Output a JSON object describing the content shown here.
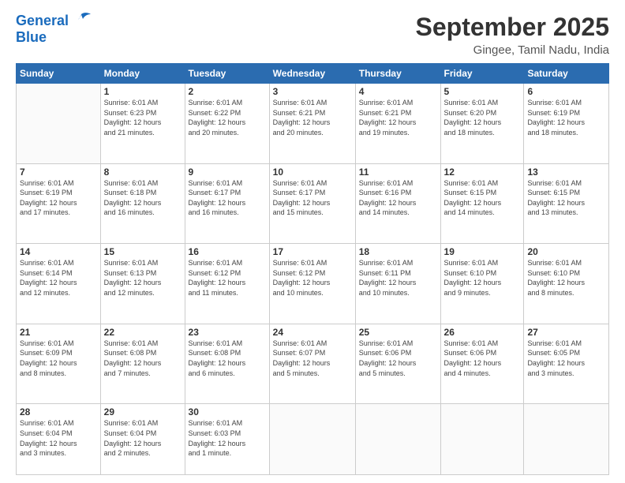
{
  "logo": {
    "line1": "General",
    "line2": "Blue"
  },
  "title": "September 2025",
  "location": "Gingee, Tamil Nadu, India",
  "weekdays": [
    "Sunday",
    "Monday",
    "Tuesday",
    "Wednesday",
    "Thursday",
    "Friday",
    "Saturday"
  ],
  "weeks": [
    [
      {
        "day": "",
        "info": ""
      },
      {
        "day": "1",
        "info": "Sunrise: 6:01 AM\nSunset: 6:23 PM\nDaylight: 12 hours\nand 21 minutes."
      },
      {
        "day": "2",
        "info": "Sunrise: 6:01 AM\nSunset: 6:22 PM\nDaylight: 12 hours\nand 20 minutes."
      },
      {
        "day": "3",
        "info": "Sunrise: 6:01 AM\nSunset: 6:21 PM\nDaylight: 12 hours\nand 20 minutes."
      },
      {
        "day": "4",
        "info": "Sunrise: 6:01 AM\nSunset: 6:21 PM\nDaylight: 12 hours\nand 19 minutes."
      },
      {
        "day": "5",
        "info": "Sunrise: 6:01 AM\nSunset: 6:20 PM\nDaylight: 12 hours\nand 18 minutes."
      },
      {
        "day": "6",
        "info": "Sunrise: 6:01 AM\nSunset: 6:19 PM\nDaylight: 12 hours\nand 18 minutes."
      }
    ],
    [
      {
        "day": "7",
        "info": "Sunrise: 6:01 AM\nSunset: 6:19 PM\nDaylight: 12 hours\nand 17 minutes."
      },
      {
        "day": "8",
        "info": "Sunrise: 6:01 AM\nSunset: 6:18 PM\nDaylight: 12 hours\nand 16 minutes."
      },
      {
        "day": "9",
        "info": "Sunrise: 6:01 AM\nSunset: 6:17 PM\nDaylight: 12 hours\nand 16 minutes."
      },
      {
        "day": "10",
        "info": "Sunrise: 6:01 AM\nSunset: 6:17 PM\nDaylight: 12 hours\nand 15 minutes."
      },
      {
        "day": "11",
        "info": "Sunrise: 6:01 AM\nSunset: 6:16 PM\nDaylight: 12 hours\nand 14 minutes."
      },
      {
        "day": "12",
        "info": "Sunrise: 6:01 AM\nSunset: 6:15 PM\nDaylight: 12 hours\nand 14 minutes."
      },
      {
        "day": "13",
        "info": "Sunrise: 6:01 AM\nSunset: 6:15 PM\nDaylight: 12 hours\nand 13 minutes."
      }
    ],
    [
      {
        "day": "14",
        "info": "Sunrise: 6:01 AM\nSunset: 6:14 PM\nDaylight: 12 hours\nand 12 minutes."
      },
      {
        "day": "15",
        "info": "Sunrise: 6:01 AM\nSunset: 6:13 PM\nDaylight: 12 hours\nand 12 minutes."
      },
      {
        "day": "16",
        "info": "Sunrise: 6:01 AM\nSunset: 6:12 PM\nDaylight: 12 hours\nand 11 minutes."
      },
      {
        "day": "17",
        "info": "Sunrise: 6:01 AM\nSunset: 6:12 PM\nDaylight: 12 hours\nand 10 minutes."
      },
      {
        "day": "18",
        "info": "Sunrise: 6:01 AM\nSunset: 6:11 PM\nDaylight: 12 hours\nand 10 minutes."
      },
      {
        "day": "19",
        "info": "Sunrise: 6:01 AM\nSunset: 6:10 PM\nDaylight: 12 hours\nand 9 minutes."
      },
      {
        "day": "20",
        "info": "Sunrise: 6:01 AM\nSunset: 6:10 PM\nDaylight: 12 hours\nand 8 minutes."
      }
    ],
    [
      {
        "day": "21",
        "info": "Sunrise: 6:01 AM\nSunset: 6:09 PM\nDaylight: 12 hours\nand 8 minutes."
      },
      {
        "day": "22",
        "info": "Sunrise: 6:01 AM\nSunset: 6:08 PM\nDaylight: 12 hours\nand 7 minutes."
      },
      {
        "day": "23",
        "info": "Sunrise: 6:01 AM\nSunset: 6:08 PM\nDaylight: 12 hours\nand 6 minutes."
      },
      {
        "day": "24",
        "info": "Sunrise: 6:01 AM\nSunset: 6:07 PM\nDaylight: 12 hours\nand 5 minutes."
      },
      {
        "day": "25",
        "info": "Sunrise: 6:01 AM\nSunset: 6:06 PM\nDaylight: 12 hours\nand 5 minutes."
      },
      {
        "day": "26",
        "info": "Sunrise: 6:01 AM\nSunset: 6:06 PM\nDaylight: 12 hours\nand 4 minutes."
      },
      {
        "day": "27",
        "info": "Sunrise: 6:01 AM\nSunset: 6:05 PM\nDaylight: 12 hours\nand 3 minutes."
      }
    ],
    [
      {
        "day": "28",
        "info": "Sunrise: 6:01 AM\nSunset: 6:04 PM\nDaylight: 12 hours\nand 3 minutes."
      },
      {
        "day": "29",
        "info": "Sunrise: 6:01 AM\nSunset: 6:04 PM\nDaylight: 12 hours\nand 2 minutes."
      },
      {
        "day": "30",
        "info": "Sunrise: 6:01 AM\nSunset: 6:03 PM\nDaylight: 12 hours\nand 1 minute."
      },
      {
        "day": "",
        "info": ""
      },
      {
        "day": "",
        "info": ""
      },
      {
        "day": "",
        "info": ""
      },
      {
        "day": "",
        "info": ""
      }
    ]
  ]
}
